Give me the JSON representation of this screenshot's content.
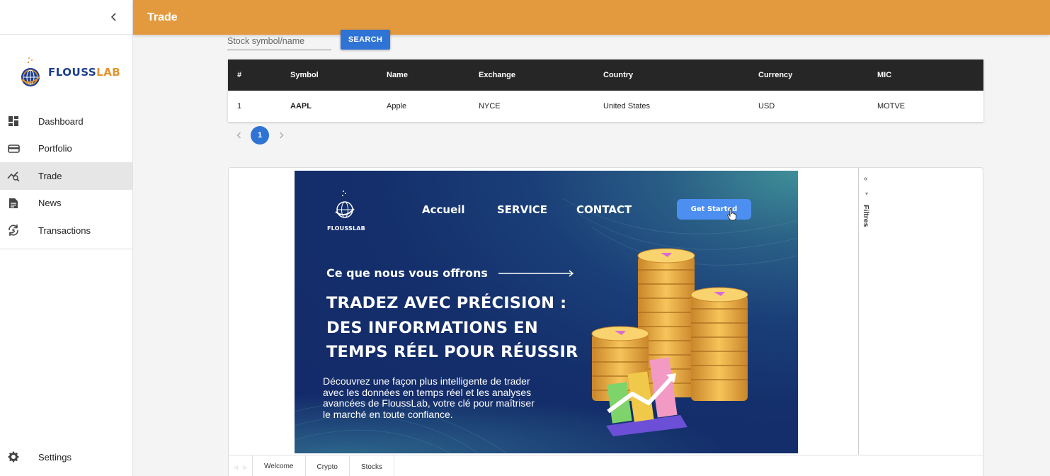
{
  "app": {
    "brand_main": "FLOUSS",
    "brand_accent": "LAB",
    "colors": {
      "header": "#e39a3f",
      "primary": "#2f73d4",
      "table_header": "#262626"
    }
  },
  "header": {
    "title": "Trade"
  },
  "sidebar": {
    "collapse_icon": "chevron-left-icon",
    "items": [
      {
        "label": "Dashboard",
        "icon": "dashboard-icon"
      },
      {
        "label": "Portfolio",
        "icon": "wallet-icon"
      },
      {
        "label": "Trade",
        "icon": "trade-chart-icon",
        "active": true
      },
      {
        "label": "News",
        "icon": "news-icon"
      },
      {
        "label": "Transactions",
        "icon": "transactions-icon"
      }
    ],
    "settings": {
      "label": "Settings",
      "icon": "gear-icon"
    }
  },
  "search": {
    "placeholder": "Stock symbol/name",
    "value": "",
    "button_label": "SEARCH"
  },
  "table": {
    "columns": [
      "#",
      "Symbol",
      "Name",
      "Exchange",
      "Country",
      "Currency",
      "MIC"
    ],
    "rows": [
      [
        "1",
        "AAPL",
        "Apple",
        "NYCE",
        "United States",
        "USD",
        "MOTVE"
      ]
    ]
  },
  "pagination": {
    "current": "1"
  },
  "report": {
    "banner": {
      "logo_text": "FLOUSSLAB",
      "nav": [
        "Accueil",
        "SERVICE",
        "CONTACT"
      ],
      "cta": "Get Started",
      "subtitle": "Ce que nous vous offrons",
      "headline": [
        "TRADEZ AVEC PRÉCISION :",
        "DES INFORMATIONS EN",
        "TEMPS RÉEL POUR RÉUSSIR"
      ],
      "description": [
        "Découvrez une façon plus intelligente de trader",
        "avec les données en temps réel et les analyses",
        "avancées de FloussLab, votre clé pour maîtriser",
        "le marché en toute confiance."
      ]
    },
    "filters_label": "Filtres",
    "tabs": [
      {
        "label": "Welcome",
        "active": true
      },
      {
        "label": "Crypto"
      },
      {
        "label": "Stocks"
      }
    ]
  }
}
